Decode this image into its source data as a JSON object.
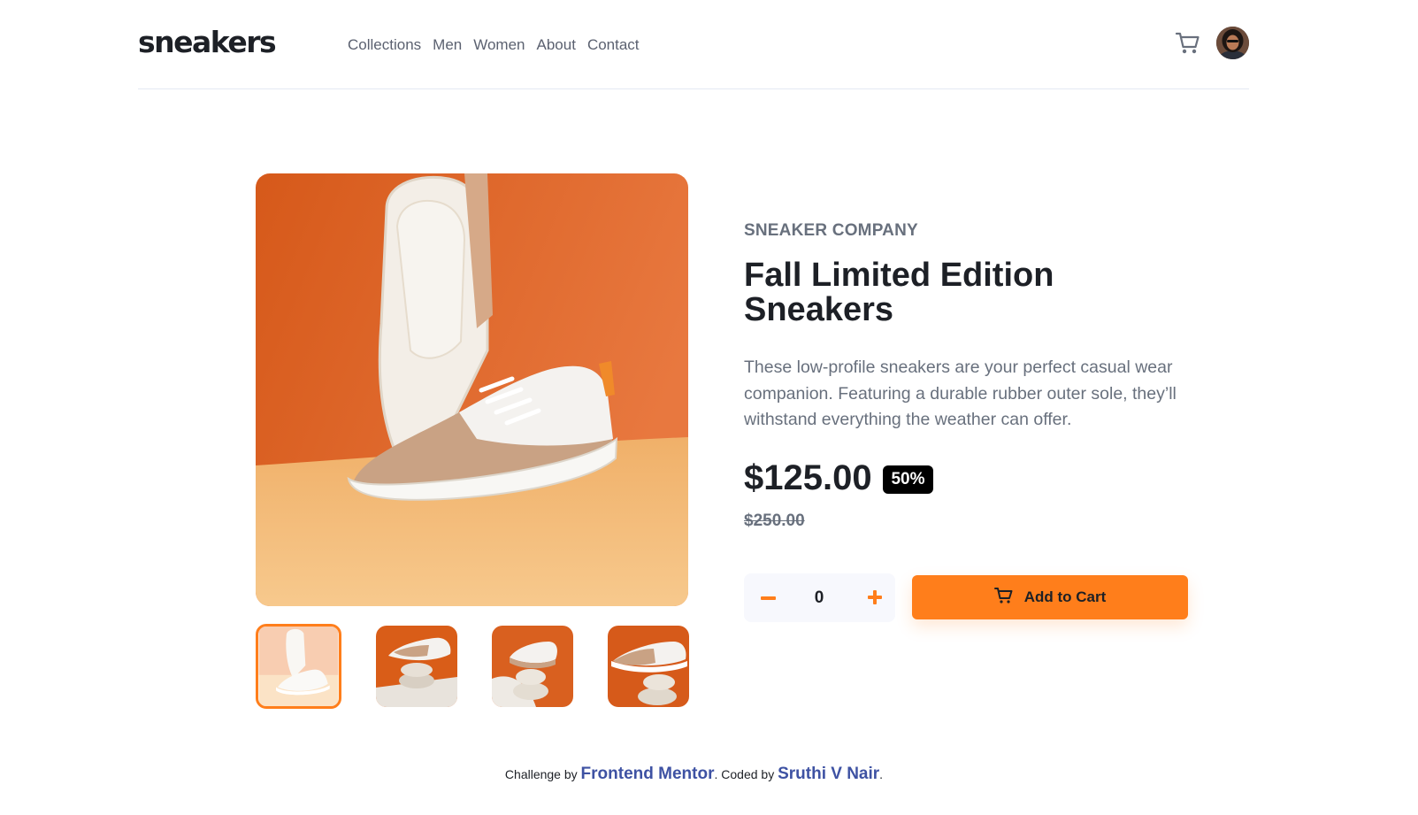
{
  "header": {
    "logo": "sneakers",
    "nav": [
      "Collections",
      "Men",
      "Women",
      "About",
      "Contact"
    ]
  },
  "gallery": {
    "thumbnail_count": 4,
    "active_thumbnail": 1
  },
  "product": {
    "company": "SNEAKER COMPANY",
    "title": "Fall Limited Edition Sneakers",
    "description": "These low-profile sneakers are your perfect casual wear companion. Featuring a durable rubber outer sole, they’ll withstand everything the weather can offer.",
    "price": "$125.00",
    "discount": "50%",
    "original_price": "$250.00"
  },
  "quantity": {
    "value": "0"
  },
  "cart_button": {
    "label": "Add to Cart"
  },
  "footer": {
    "prefix": "Challenge by ",
    "mentor_link": "Frontend Mentor",
    "middle": ". Coded by ",
    "author_link": "Sruthi V Nair",
    "suffix": "."
  },
  "colors": {
    "accent": "#ff7e1b",
    "text_dark": "#1d2026",
    "text_muted": "#68707d",
    "link": "#3e52a3"
  },
  "icons": [
    "cart-icon",
    "avatar",
    "minus-icon",
    "plus-icon"
  ]
}
